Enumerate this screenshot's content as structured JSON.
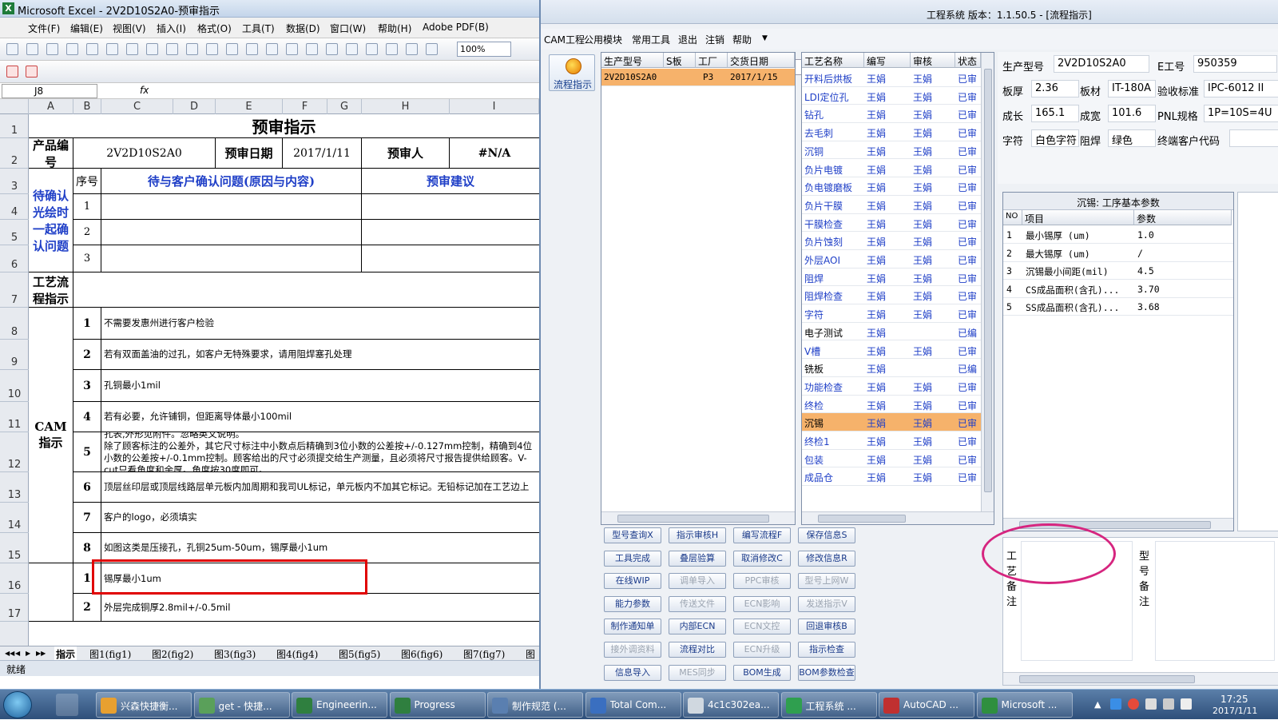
{
  "excel": {
    "title": "Microsoft Excel - 2V2D10S2A0-预审指示",
    "menus": [
      "文件(F)",
      "编辑(E)",
      "视图(V)",
      "插入(I)",
      "格式(O)",
      "工具(T)",
      "数据(D)",
      "窗口(W)",
      "帮助(H)",
      "Adobe PDF(B)"
    ],
    "zoom": "100%",
    "name_box": "J8",
    "fx": "fx",
    "columns": [
      "A",
      "B",
      "C",
      "D",
      "E",
      "F",
      "G",
      "H",
      "I"
    ],
    "rows": [
      "1",
      "2",
      "3",
      "4",
      "5",
      "6",
      "7",
      "8",
      "9",
      "10",
      "11",
      "12",
      "13",
      "14",
      "15",
      "16",
      "17"
    ],
    "sheet": {
      "title": "预审指示",
      "product_label": "产品编号",
      "product_value": "2V2D10S2A0",
      "date_label": "预审日期",
      "date_value": "2017/1/11",
      "reviewer_label": "预审人",
      "reviewer_value": "#N/A",
      "pending_label": "待确认光绘时一起确认问题",
      "seq_header": "序号",
      "issue_header": "待与客户确认问题(原因与内容)",
      "advice_header": "预审建议",
      "pending_nums": [
        "1",
        "2",
        "3"
      ],
      "flow_label": "工艺流程指示",
      "cam_label": "CAM指示",
      "cam_items": [
        {
          "n": "1",
          "t": "不需要发惠州进行客户检验"
        },
        {
          "n": "2",
          "t": "若有双面盖油的过孔，如客户无特殊要求，请用阻焊塞孔处理"
        },
        {
          "n": "3",
          "t": "孔铜最小1mil"
        },
        {
          "n": "4",
          "t": "若有必要，允许铺铜，但距离导体最小100mil"
        },
        {
          "n": "5",
          "t": "孔表,外形见附件。忽略英文说明。\n除了顾客标注的公差外，其它尺寸标注中小数点后精确到3位小数的公差按+/-0.127mm控制，精确到4位小数的公差按+/-0.1mm控制。顾客给出的尺寸必须提交给生产测量，且必须将尺寸报告提供给顾客。V-cut只看角度和余厚。角度按30度即可。"
        },
        {
          "n": "6",
          "t": "顶层丝印层或顶层线路层单元板内加周期和我司UL标记，单元板内不加其它标记。无铅标记加在工艺边上"
        },
        {
          "n": "7",
          "t": "客户的logo，必须填实"
        },
        {
          "n": "8",
          "t": "如图这类是压接孔，孔铜25um-50um，锡厚最小1um"
        }
      ],
      "next_items": [
        {
          "n": "1",
          "t": "锡厚最小1um"
        },
        {
          "n": "2",
          "t": "外层完成铜厚2.8mil+/-0.5mil"
        }
      ]
    },
    "sheet_tabs": [
      "指示",
      "图1(fig1)",
      "图2(fig2)",
      "图3(fig3)",
      "图4(fig4)",
      "图5(fig5)",
      "图6(fig6)",
      "图7(fig7)",
      "图8(f"
    ],
    "status": "就绪"
  },
  "eng": {
    "title": "工程系统  版本：1.1.50.5 - [流程指示]",
    "menus": [
      "CAM工程",
      "公用模块",
      "常用工具",
      "退出",
      "注销",
      "帮助"
    ],
    "flow_button": "流程指示",
    "orders": {
      "headers": [
        "生产型号",
        "S板",
        "工厂",
        "交货日期"
      ],
      "rows": [
        {
          "model": "2V2D10S2A0",
          "s": "",
          "factory": "P3",
          "date": "2017/1/15"
        }
      ]
    },
    "process": {
      "headers": [
        "工艺名称",
        "编写",
        "审核",
        "状态"
      ],
      "rows": [
        {
          "name": "开料后烘板",
          "w": "王娟",
          "r": "王娟",
          "s": "已审"
        },
        {
          "name": "LDI定位孔",
          "w": "王娟",
          "r": "王娟",
          "s": "已审"
        },
        {
          "name": "钻孔",
          "w": "王娟",
          "r": "王娟",
          "s": "已审"
        },
        {
          "name": "去毛刺",
          "w": "王娟",
          "r": "王娟",
          "s": "已审"
        },
        {
          "name": "沉铜",
          "w": "王娟",
          "r": "王娟",
          "s": "已审"
        },
        {
          "name": "负片电镀",
          "w": "王娟",
          "r": "王娟",
          "s": "已审"
        },
        {
          "name": "负电镀磨板",
          "w": "王娟",
          "r": "王娟",
          "s": "已审"
        },
        {
          "name": "负片干膜",
          "w": "王娟",
          "r": "王娟",
          "s": "已审"
        },
        {
          "name": "干膜检查",
          "w": "王娟",
          "r": "王娟",
          "s": "已审"
        },
        {
          "name": "负片蚀刻",
          "w": "王娟",
          "r": "王娟",
          "s": "已审"
        },
        {
          "name": "外层AOI",
          "w": "王娟",
          "r": "王娟",
          "s": "已审"
        },
        {
          "name": "阻焊",
          "w": "王娟",
          "r": "王娟",
          "s": "已审"
        },
        {
          "name": "阻焊检查",
          "w": "王娟",
          "r": "王娟",
          "s": "已审"
        },
        {
          "name": "字符",
          "w": "王娟",
          "r": "王娟",
          "s": "已审"
        },
        {
          "name": "电子测试",
          "w": "王娟",
          "r": "",
          "s": "已编"
        },
        {
          "name": "V槽",
          "w": "王娟",
          "r": "王娟",
          "s": "已审"
        },
        {
          "name": "铣板",
          "w": "王娟",
          "r": "",
          "s": "已编"
        },
        {
          "name": "功能检查",
          "w": "王娟",
          "r": "王娟",
          "s": "已审"
        },
        {
          "name": "终检",
          "w": "王娟",
          "r": "王娟",
          "s": "已审"
        },
        {
          "name": "沉锡",
          "w": "王娟",
          "r": "王娟",
          "s": "已审"
        },
        {
          "name": "终检1",
          "w": "王娟",
          "r": "王娟",
          "s": "已审"
        },
        {
          "name": "包装",
          "w": "王娟",
          "r": "王娟",
          "s": "已审"
        },
        {
          "name": "成品仓",
          "w": "王娟",
          "r": "王娟",
          "s": "已审"
        }
      ]
    },
    "buttons": [
      [
        {
          "l": "型号查询X",
          "d": false
        },
        {
          "l": "指示审核H",
          "d": false
        },
        {
          "l": "编写流程F",
          "d": false
        },
        {
          "l": "保存信息S",
          "d": false
        }
      ],
      [
        {
          "l": "工具完成",
          "d": false
        },
        {
          "l": "叠层验算",
          "d": false
        },
        {
          "l": "取消修改C",
          "d": false
        },
        {
          "l": "修改信息R",
          "d": false
        }
      ],
      [
        {
          "l": "在线WIP",
          "d": false
        },
        {
          "l": "调单导入",
          "d": true
        },
        {
          "l": "PPC审核",
          "d": true
        },
        {
          "l": "型号上网W",
          "d": true
        }
      ],
      [
        {
          "l": "能力参数",
          "d": false
        },
        {
          "l": "传送文件",
          "d": true
        },
        {
          "l": "ECN影响",
          "d": true
        },
        {
          "l": "发送指示V",
          "d": true
        }
      ],
      [
        {
          "l": "制作通知单",
          "d": false
        },
        {
          "l": "内部ECN",
          "d": false
        },
        {
          "l": "ECN文控",
          "d": true
        },
        {
          "l": "回退审核B",
          "d": false
        }
      ],
      [
        {
          "l": "接外调资料",
          "d": true
        },
        {
          "l": "流程对比",
          "d": false
        },
        {
          "l": "ECN升级",
          "d": true
        },
        {
          "l": "指示检查",
          "d": false
        }
      ],
      [
        {
          "l": "信息导入",
          "d": false
        },
        {
          "l": "MES同步",
          "d": true
        },
        {
          "l": "BOM生成",
          "d": false
        },
        {
          "l": "BOM参数检查",
          "d": false
        }
      ]
    ],
    "info": [
      [
        {
          "label": "生产型号",
          "value": "2V2D10S2A0"
        },
        {
          "label": "E工号",
          "value": "950359"
        }
      ],
      [
        {
          "label": "板厚",
          "value": "2.36"
        },
        {
          "label": "板材",
          "value": "IT-180A"
        },
        {
          "label": "验收标准",
          "value": "IPC-6012 II"
        }
      ],
      [
        {
          "label": "成长",
          "value": "165.1"
        },
        {
          "label": "成宽",
          "value": "101.6"
        },
        {
          "label": "PNL规格",
          "value": "1P=10S=4U"
        }
      ],
      [
        {
          "label": "字符",
          "value": "白色字符"
        },
        {
          "label": "阻焊",
          "value": "绿色"
        },
        {
          "label": "终端客户代码",
          "value": ""
        }
      ]
    ],
    "params": {
      "title": "沉锡: 工序基本参数",
      "headers": [
        "NO",
        "项目",
        "参数"
      ],
      "rows": [
        {
          "no": "1",
          "item": "最小锡厚 (um)",
          "val": "1.0"
        },
        {
          "no": "2",
          "item": "最大锡厚 (um)",
          "val": "/"
        },
        {
          "no": "3",
          "item": "沉锡最小间距(mil)",
          "val": "4.5"
        },
        {
          "no": "4",
          "item": "CS成品面积(含孔)...",
          "val": "3.70"
        },
        {
          "no": "5",
          "item": "SS成品面积(含孔)...",
          "val": "3.68"
        }
      ]
    },
    "remark_process": "工艺备注",
    "remark_model": "型号备注"
  },
  "taskbar": {
    "tasks": [
      "兴森快捷衡...",
      "get - 快捷...",
      "Engineerin...",
      "Progress",
      "制作规范 (...",
      "Total Com...",
      "4c1c302ea...",
      "工程系统 ...",
      "AutoCAD ...",
      "Microsoft ..."
    ],
    "time": "17:25",
    "date": "2017/1/11"
  },
  "colors": {
    "highlight": "#f6b26b",
    "red_box": "#e00000",
    "ellipse": "#d6257f",
    "link_blue": "#1f3fc7"
  }
}
